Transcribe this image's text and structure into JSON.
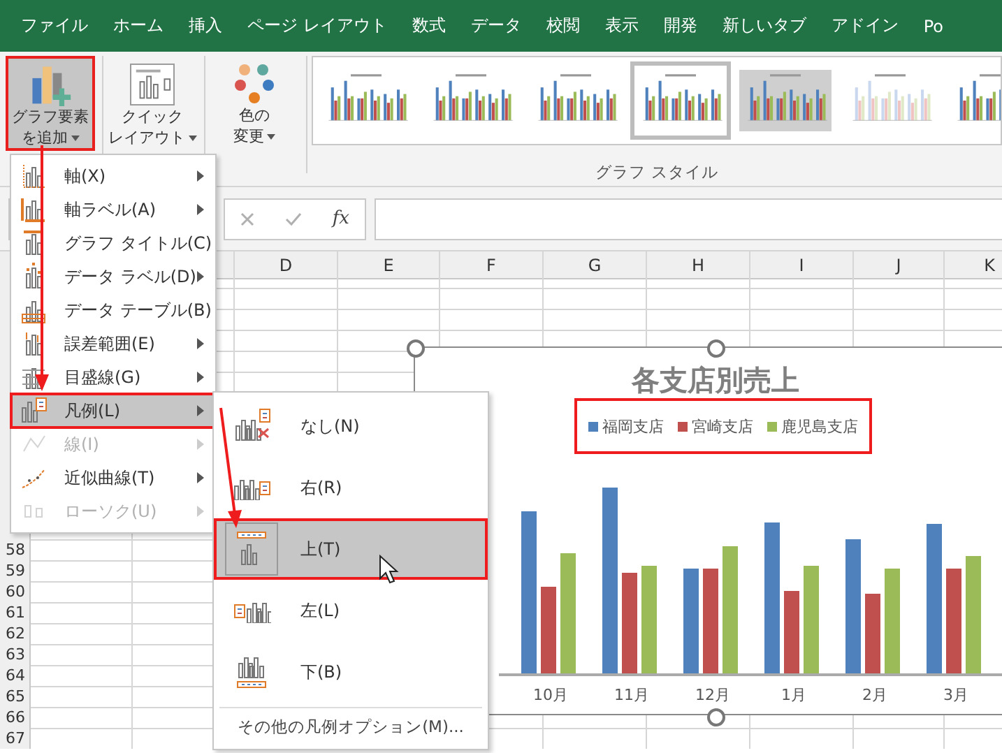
{
  "tabs": [
    {
      "label": "ファイル"
    },
    {
      "label": "ホーム"
    },
    {
      "label": "挿入"
    },
    {
      "label": "ページ レイアウト"
    },
    {
      "label": "数式"
    },
    {
      "label": "データ"
    },
    {
      "label": "校閲"
    },
    {
      "label": "表示"
    },
    {
      "label": "開発"
    },
    {
      "label": "新しいタブ"
    },
    {
      "label": "アドイン"
    },
    {
      "label": "Po"
    }
  ],
  "ribbon": {
    "buttons": [
      {
        "kind": "add-element",
        "lines": [
          "グラフ要素",
          "を追加"
        ],
        "selected": true
      },
      {
        "kind": "layout",
        "lines": [
          "クイック",
          "レイアウト"
        ],
        "selected": false
      },
      {
        "kind": "colors",
        "lines": [
          "色の",
          "変更"
        ],
        "selected": false
      }
    ],
    "chart_styles": [
      {
        "selected": false
      },
      {
        "selected": false
      },
      {
        "selected": false
      },
      {
        "selected": true
      },
      {
        "selected": false
      },
      {
        "selected": false
      },
      {
        "selected": false
      }
    ],
    "group_label": "グラフ スタイル"
  },
  "formula_bar": {
    "function_label": "fx"
  },
  "columns": [
    "D",
    "E",
    "F",
    "G",
    "H",
    "I",
    "J",
    "K"
  ],
  "rows": [
    "58",
    "59",
    "60",
    "61",
    "62",
    "63",
    "64",
    "65",
    "66",
    "67"
  ],
  "chart": {
    "title": "各支店別売上",
    "legend": [
      {
        "name": "福岡支店",
        "color": "#4f81bd"
      },
      {
        "name": "宮崎支店",
        "color": "#c0504d"
      },
      {
        "name": "鹿児島支店",
        "color": "#9bbb59"
      }
    ],
    "categories": [
      "10月",
      "11月",
      "12月",
      "1月",
      "2月",
      "3月"
    ]
  },
  "menu": {
    "items": [
      {
        "kind": "axis",
        "label": "軸(X)",
        "disabled": false,
        "selected": false
      },
      {
        "kind": "axis-title",
        "label": "軸ラベル(A)",
        "disabled": false,
        "selected": false
      },
      {
        "kind": "chart-title",
        "label": "グラフ タイトル(C)",
        "disabled": false,
        "selected": false
      },
      {
        "kind": "data-labels",
        "label": "データ ラベル(D)",
        "disabled": false,
        "selected": false
      },
      {
        "kind": "data-table",
        "label": "データ テーブル(B)",
        "disabled": false,
        "selected": false
      },
      {
        "kind": "error-bars",
        "label": "誤差範囲(E)",
        "disabled": false,
        "selected": false
      },
      {
        "kind": "gridlines",
        "label": "目盛線(G)",
        "disabled": false,
        "selected": false
      },
      {
        "kind": "legend",
        "label": "凡例(L)",
        "disabled": false,
        "selected": true
      },
      {
        "kind": "lines",
        "label": "線(I)",
        "disabled": true,
        "selected": false
      },
      {
        "kind": "trendline",
        "label": "近似曲線(T)",
        "disabled": false,
        "selected": false
      },
      {
        "kind": "updown",
        "label": "ローソク(U)",
        "disabled": true,
        "selected": false
      }
    ]
  },
  "submenu": {
    "items": [
      {
        "kind": "none",
        "label": "なし(N)",
        "selected": false
      },
      {
        "kind": "right",
        "label": "右(R)",
        "selected": false
      },
      {
        "kind": "top",
        "label": "上(T)",
        "selected": true
      },
      {
        "kind": "left",
        "label": "左(L)",
        "selected": false
      },
      {
        "kind": "bottom",
        "label": "下(B)",
        "selected": false
      }
    ],
    "footer": "その他の凡例オプション(M)..."
  }
}
